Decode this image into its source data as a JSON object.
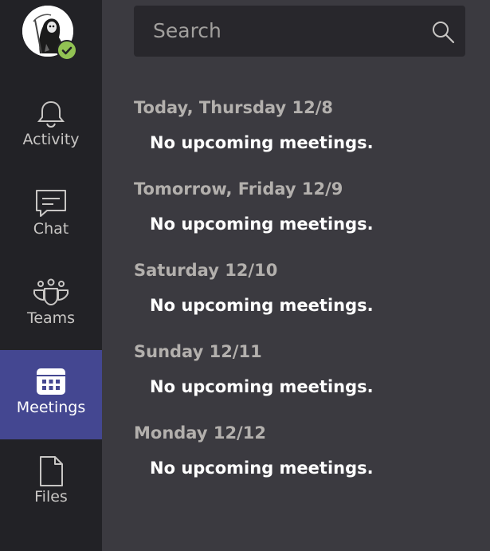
{
  "nav": {
    "items": [
      {
        "label": "Activity",
        "icon": "bell-icon"
      },
      {
        "label": "Chat",
        "icon": "chat-icon"
      },
      {
        "label": "Teams",
        "icon": "teams-icon"
      },
      {
        "label": "Meetings",
        "icon": "calendar-icon",
        "active": true
      },
      {
        "label": "Files",
        "icon": "file-icon"
      }
    ]
  },
  "profile": {
    "status": "available",
    "status_color": "#92c353"
  },
  "search": {
    "placeholder": "Search"
  },
  "meetings": {
    "days": [
      {
        "title": "Today, Thursday 12/8",
        "empty_text": "No upcoming meetings."
      },
      {
        "title": "Tomorrow, Friday 12/9",
        "empty_text": "No upcoming meetings."
      },
      {
        "title": "Saturday 12/10",
        "empty_text": "No upcoming meetings."
      },
      {
        "title": "Sunday 12/11",
        "empty_text": "No upcoming meetings."
      },
      {
        "title": "Monday 12/12",
        "empty_text": "No upcoming meetings."
      }
    ]
  },
  "colors": {
    "rail_bg": "#222226",
    "content_bg": "#3b3a40",
    "active_bg": "#444791",
    "search_bg": "#28272c"
  }
}
